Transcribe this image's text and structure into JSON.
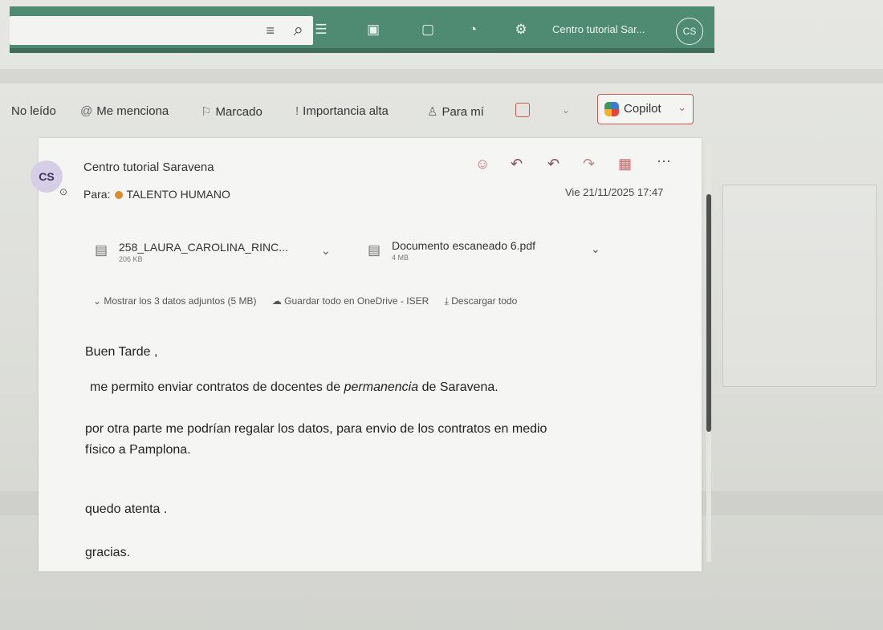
{
  "topbar": {
    "search_placeholder": "",
    "account_name": "Centro tutorial Sar...",
    "account_initials": "CS",
    "icons": [
      "filter-icon",
      "search-icon",
      "teams-icon",
      "calendar-icon",
      "whiteboard-icon",
      "bell-icon",
      "settings-icon"
    ]
  },
  "filters": {
    "items": [
      {
        "label": "No leído",
        "icon": ""
      },
      {
        "label": "Me menciona",
        "icon": "@"
      },
      {
        "label": "Marcado",
        "icon": "⚐"
      },
      {
        "label": "Importancia alta",
        "icon": "!"
      },
      {
        "label": "Para mí",
        "icon": "♙"
      }
    ],
    "copilot_label": "Copilot"
  },
  "message": {
    "sender_initials": "CS",
    "sender_name": "Centro tutorial Saravena",
    "to_label": "Para:",
    "to_value": "TALENTO HUMANO",
    "date": "Vie 21/11/2025 17:47",
    "attachments": [
      {
        "name": "258_LAURA_CAROLINA_RINC...",
        "size": "206 KB"
      },
      {
        "name": "Documento escaneado 6.pdf",
        "size": "4 MB"
      }
    ],
    "attachment_actions": {
      "show_all": "Mostrar los 3 datos adjuntos (5 MB)",
      "save_onedrive": "Guardar todo en OneDrive - ISER",
      "download_all": "Descargar todo"
    },
    "body": {
      "greeting": "Buen Tarde ,",
      "line1_pre": "me permito enviar contratos de docentes de ",
      "line1_em": "permanencia",
      "line1_post": " de Saravena.",
      "line2": "por otra parte me podrían regalar los datos,  para envio de  los contratos en medio",
      "line3": "físico a Pamplona.",
      "line4": "quedo atenta .",
      "line5": "gracias."
    }
  },
  "colors": {
    "topbar": "#4f8a73",
    "accent_red": "#c85b4e",
    "avatar_bg": "#d6cde6"
  }
}
